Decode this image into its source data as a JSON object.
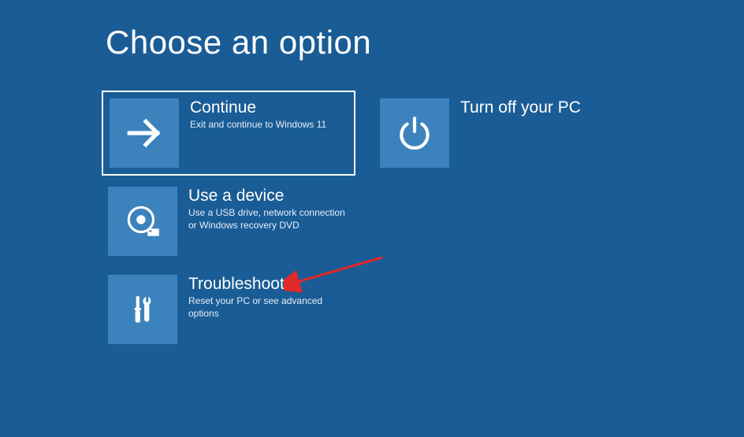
{
  "page_title": "Choose an option",
  "tiles": {
    "continue": {
      "title": "Continue",
      "desc": "Exit and continue to Windows 11",
      "icon": "arrow-right-icon",
      "selected": true
    },
    "turnoff": {
      "title": "Turn off your PC",
      "desc": "",
      "icon": "power-icon",
      "selected": false
    },
    "usedevice": {
      "title": "Use a device",
      "desc": "Use a USB drive, network connection or Windows recovery DVD",
      "icon": "disc-usb-icon",
      "selected": false
    },
    "troubleshoot": {
      "title": "Troubleshoot",
      "desc": "Reset your PC or see advanced options",
      "icon": "tools-icon",
      "selected": false
    }
  },
  "annotation": {
    "type": "arrow",
    "target": "troubleshoot",
    "color": "#E22828"
  }
}
